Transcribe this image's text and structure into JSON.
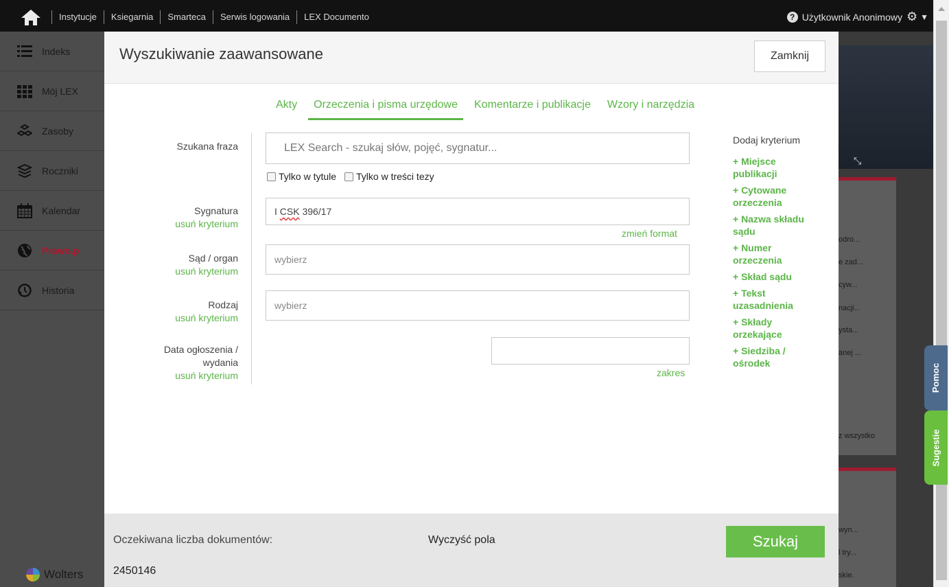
{
  "topbar": {
    "links": [
      "Instytucje",
      "Ksiegarnia",
      "Smarteca",
      "Serwis logowania",
      "LEX Documento"
    ],
    "user_label": "Użytkownik Anonimowy"
  },
  "sidebar": {
    "items": [
      {
        "label": "Indeks",
        "icon": "list-icon"
      },
      {
        "label": "Mój LEX",
        "icon": "grid-icon"
      },
      {
        "label": "Zasoby",
        "icon": "cubes-icon"
      },
      {
        "label": "Roczniki",
        "icon": "books-icon"
      },
      {
        "label": "Kalendar",
        "icon": "calendar-icon"
      },
      {
        "label": "Prawo.p",
        "icon": "globe-icon"
      },
      {
        "label": "Historia",
        "icon": "history-icon"
      }
    ],
    "footer_brand": "Wolters"
  },
  "background": {
    "card1_lines": [
      "odro...",
      "e zad...",
      "cyw...",
      "nacji...",
      "ysta...",
      "anej ...",
      "z wszystko"
    ],
    "card2_lines": [
      "wyn...",
      "l try...",
      "skie."
    ]
  },
  "side_tabs": {
    "help": "Pomoc",
    "suggestions": "Sugestie"
  },
  "modal": {
    "title": "Wyszukiwanie zaawansowane",
    "close_label": "Zamknij",
    "tabs": [
      "Akty",
      "Orzeczenia i pisma urzędowe",
      "Komentarze i publikacje",
      "Wzory i narzędzia"
    ],
    "active_tab": "Orzeczenia i pisma urzędowe",
    "search": {
      "label": "Szukana fraza",
      "placeholder": "LEX Search - szukaj słów, pojęć, sygnatur...",
      "check_title": "Tylko w tytule",
      "check_thesis": "Tylko w treści tezy"
    },
    "remove_label": "usuń kryterium",
    "sygnatura": {
      "label": "Sygnatura",
      "value_prefix": "I ",
      "value_mark": "CSK",
      "value_suffix": " 396/17",
      "change_format": "zmień format"
    },
    "sad": {
      "label": "Sąd / organ",
      "placeholder": "wybierz"
    },
    "rodzaj": {
      "label": "Rodzaj",
      "placeholder": "wybierz"
    },
    "data": {
      "label_line1": "Data ogłoszenia /",
      "label_line2": "wydania",
      "range_link": "zakres"
    },
    "criteria": {
      "heading": "Dodaj kryterium",
      "items": [
        [
          "+ Miejsce",
          "publikacji"
        ],
        [
          "+ Cytowane",
          "orzeczenia"
        ],
        [
          "+ Nazwa składu",
          "sądu"
        ],
        [
          "+ Numer",
          "orzeczenia"
        ],
        [
          "+ Skład sądu"
        ],
        [
          "+ Tekst",
          "uzasadnienia"
        ],
        [
          "+ Składy",
          "orzekające"
        ],
        [
          "+ Siedziba /",
          "ośrodek"
        ]
      ]
    },
    "footer": {
      "expected_label": "Oczekiwana liczba dokumentów:",
      "expected_value": "2450146",
      "clear_label": "Wyczyść pola",
      "search_label": "Szukaj"
    }
  }
}
